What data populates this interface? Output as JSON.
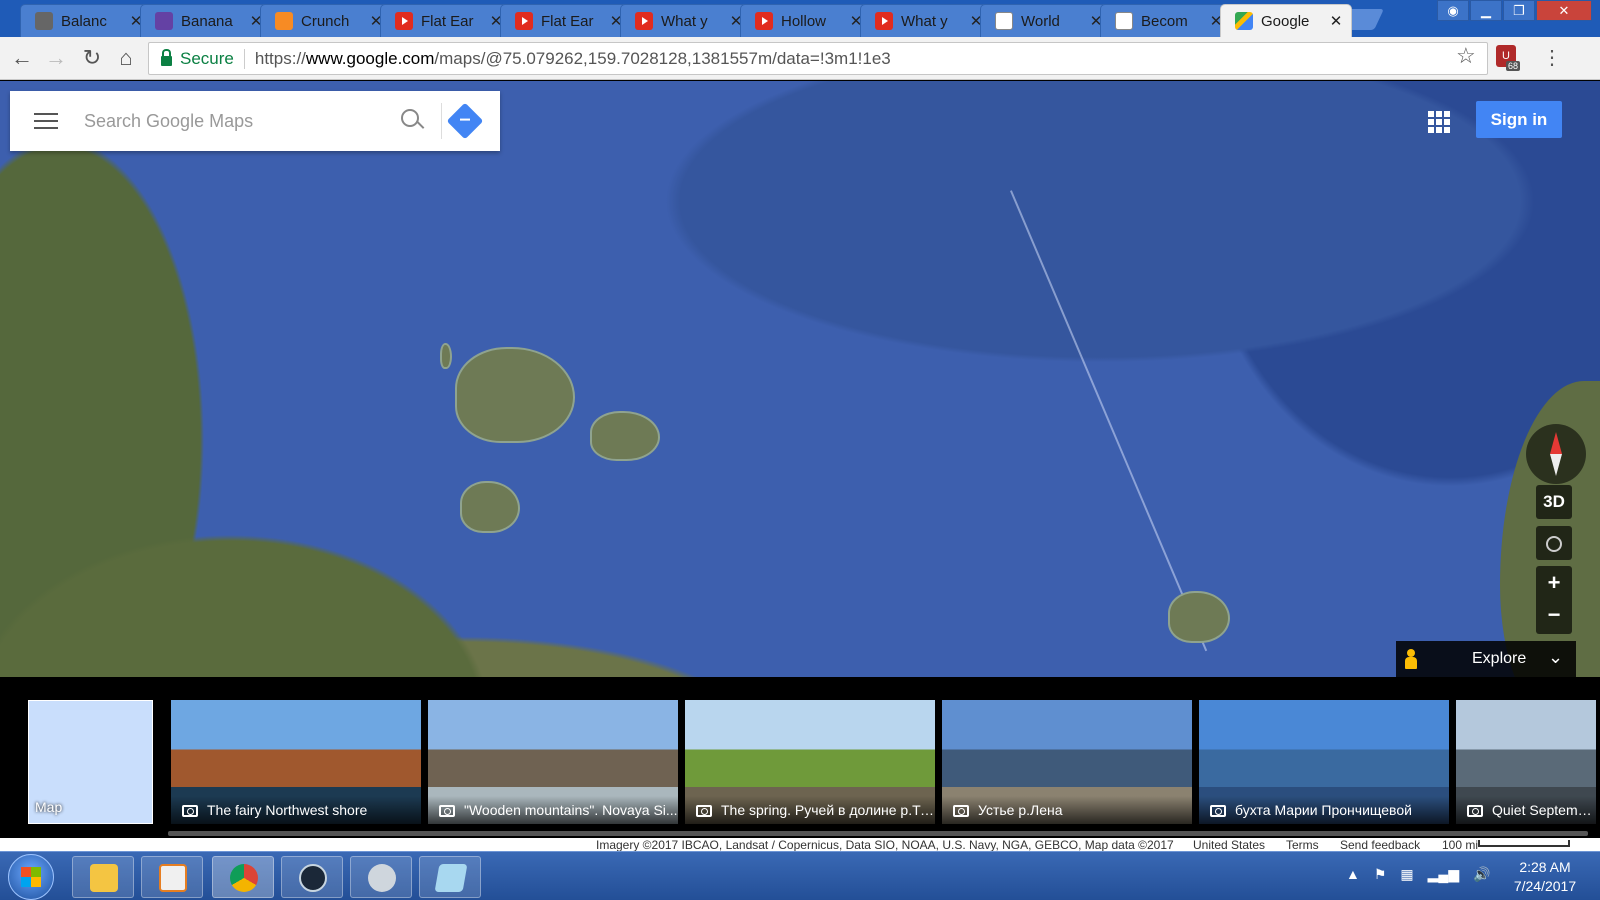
{
  "browser": {
    "tabs": [
      {
        "label": "Balanc",
        "favicon": "generic-icon",
        "active": false
      },
      {
        "label": "Banana",
        "favicon": "twitch-icon",
        "active": false
      },
      {
        "label": "Crunch",
        "favicon": "crunchyroll-icon",
        "active": false
      },
      {
        "label": "Flat Ear",
        "favicon": "youtube-icon",
        "active": false
      },
      {
        "label": "Flat Ear",
        "favicon": "youtube-icon",
        "active": false
      },
      {
        "label": "What y",
        "favicon": "youtube-icon",
        "active": false
      },
      {
        "label": "Hollow",
        "favicon": "youtube-icon",
        "active": false
      },
      {
        "label": "What y",
        "favicon": "youtube-icon",
        "active": false
      },
      {
        "label": "World",
        "favicon": "document-icon",
        "active": false
      },
      {
        "label": "Becom",
        "favicon": "document-icon",
        "active": false
      },
      {
        "label": "Google",
        "favicon": "google-maps-icon",
        "active": true
      }
    ],
    "close_glyph": "✕",
    "security_label": "Secure",
    "url_scheme": "https://",
    "url_host": "www.google.com",
    "url_path": "/maps/@75.079262,159.7028128,1381557m/data=!3m1!1e3",
    "extension_badge": "68"
  },
  "maps": {
    "search_placeholder": "Search Google Maps",
    "signin_label": "Sign in",
    "btn_3d": "3D",
    "zoom_in": "+",
    "zoom_out": "−",
    "explore_label": "Explore",
    "map_thumb_label": "Map",
    "photos": [
      {
        "caption": "The fairy Northwest shore",
        "colors": [
          "#6ea7e2",
          "#a0582e",
          "#1c3a52"
        ]
      },
      {
        "caption": "\"Wooden mountains\". Novaya Si...",
        "colors": [
          "#8ab4e4",
          "#6f6252",
          "#aab7bd"
        ]
      },
      {
        "caption": "The spring. Ручей в долине р.Та...",
        "colors": [
          "#b9d6ee",
          "#6f9a3a",
          "#6d6450"
        ]
      },
      {
        "caption": "Устье р.Лена",
        "colors": [
          "#5f8fd0",
          "#3f5a7a",
          "#8b8270"
        ]
      },
      {
        "caption": "бухта Марии Прончищевой",
        "colors": [
          "#4a88d6",
          "#3a6aa0",
          "#2b4e7e"
        ]
      },
      {
        "caption": "Quiet September",
        "colors": [
          "#b4c8dc",
          "#5a6a78",
          "#3f4850"
        ]
      }
    ],
    "footer": {
      "imagery": "Imagery ©2017 IBCAO, Landsat / Copernicus, Data SIO, NOAA, U.S. Navy, NGA, GEBCO, Map data ©2017",
      "region": "United States",
      "terms": "Terms",
      "feedback": "Send feedback",
      "scale": "100 mi"
    }
  },
  "taskbar": {
    "time": "2:28 AM",
    "date": "7/24/2017",
    "apps": [
      "file-explorer-icon",
      "media-player-icon",
      "chrome-icon",
      "steam-icon",
      "speaker-app-icon",
      "notepad-icon"
    ]
  }
}
